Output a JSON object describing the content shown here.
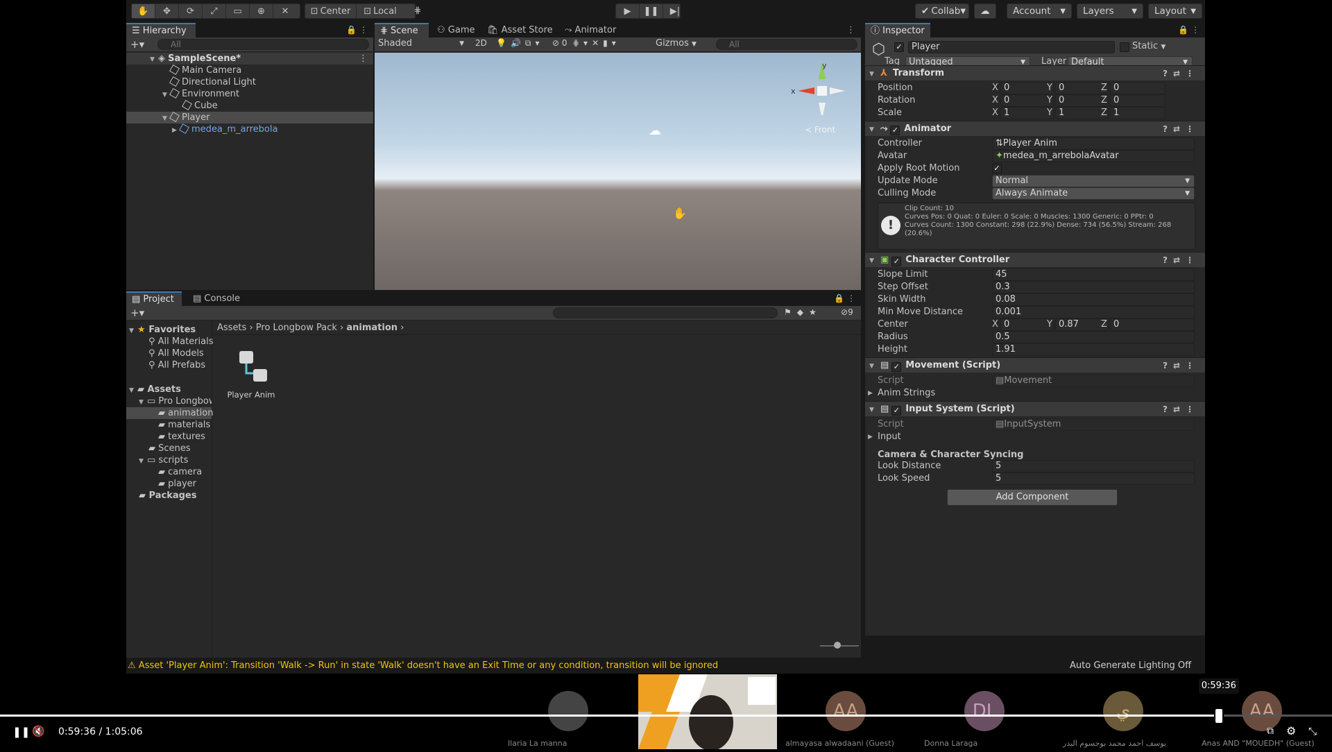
{
  "toolbar": {
    "tools": [
      "✋",
      "✥",
      "⟳",
      "⤢",
      "▭",
      "⊕",
      "✕"
    ],
    "pivot": "Center",
    "space": "Local",
    "collab": "Collab",
    "account": "Account",
    "layers": "Layers",
    "layout": "Layout"
  },
  "hierarchy": {
    "tab": "Hierarchy",
    "search_placeholder": "All",
    "scene": "SampleScene*",
    "items": [
      "Main Camera",
      "Directional Light",
      "Environment",
      "Cube",
      "Player",
      "medea_m_arrebola"
    ]
  },
  "scene": {
    "tabs": [
      "Scene",
      "Game",
      "Asset Store",
      "Animator"
    ],
    "shading": "Shaded",
    "mode_2d": "2D",
    "hidden_count": "0",
    "gizmos": "Gizmos",
    "search_placeholder": "All",
    "gizmo_label": "Front",
    "axis_x": "x",
    "axis_y": "y"
  },
  "project": {
    "tabs": [
      "Project",
      "Console"
    ],
    "favorites_label": "Favorites",
    "favorites": [
      "All Materials",
      "All Models",
      "All Prefabs"
    ],
    "assets_label": "Assets",
    "tree": [
      "Pro Longbow",
      "animation",
      "materials",
      "textures",
      "Scenes",
      "scripts",
      "camera",
      "player"
    ],
    "packages_label": "Packages",
    "breadcrumb": [
      "Assets",
      "Pro Longbow Pack",
      "animation"
    ],
    "hidden_count": "9",
    "asset_name": "Player Anim"
  },
  "inspector": {
    "tab": "Inspector",
    "object_name": "Player",
    "static_label": "Static",
    "tag_label": "Tag",
    "tag_value": "Untagged",
    "layer_label": "Layer",
    "layer_value": "Default",
    "transform": {
      "title": "Transform",
      "position_label": "Position",
      "position": [
        "0",
        "0",
        "0"
      ],
      "rotation_label": "Rotation",
      "rotation": [
        "0",
        "0",
        "0"
      ],
      "scale_label": "Scale",
      "scale": [
        "1",
        "1",
        "1"
      ]
    },
    "animator": {
      "title": "Animator",
      "controller_label": "Controller",
      "controller": "Player Anim",
      "avatar_label": "Avatar",
      "avatar": "medea_m_arrebolaAvatar",
      "root_motion_label": "Apply Root Motion",
      "update_mode_label": "Update Mode",
      "update_mode": "Normal",
      "culling_mode_label": "Culling Mode",
      "culling_mode": "Always Animate",
      "info_1": "Clip Count: 10",
      "info_2": "Curves Pos: 0 Quat: 0 Euler: 0 Scale: 0 Muscles: 1300 Generic: 0 PPtr: 0",
      "info_3": "Curves Count: 1300 Constant: 298 (22.9%) Dense: 734 (56.5%) Stream: 268",
      "info_4": "(20.6%)"
    },
    "character_controller": {
      "title": "Character Controller",
      "slope_limit_label": "Slope Limit",
      "slope_limit": "45",
      "step_offset_label": "Step Offset",
      "step_offset": "0.3",
      "skin_width_label": "Skin Width",
      "skin_width": "0.08",
      "min_move_label": "Min Move Distance",
      "min_move": "0.001",
      "center_label": "Center",
      "center": [
        "0",
        "0.87",
        "0"
      ],
      "radius_label": "Radius",
      "radius": "0.5",
      "height_label": "Height",
      "height": "1.91"
    },
    "movement": {
      "title": "Movement (Script)",
      "script_label": "Script",
      "script": "Movement",
      "anim_strings": "Anim Strings"
    },
    "input_system": {
      "title": "Input System (Script)",
      "script_label": "Script",
      "script": "InputSystem",
      "input_label": "Input",
      "sync_heading": "Camera & Character Syncing",
      "look_distance_label": "Look Distance",
      "look_distance": "5",
      "look_speed_label": "Look Speed",
      "look_speed": "5"
    },
    "add_component": "Add Component"
  },
  "status": {
    "warning": "Asset 'Player Anim': Transition 'Walk -> Run' in state 'Walk' doesn't have an Exit Time or any condition, transition will be ignored",
    "lighting": "Auto Generate Lighting Off"
  },
  "video": {
    "current_time": "0:59:36",
    "separator": "/",
    "duration": "1:05:06",
    "tooltip_time": "0:59:36",
    "progress": 0.915,
    "participants": [
      {
        "initials": "",
        "name": "Ilaria  La manna"
      },
      {
        "initials": "",
        "name": ""
      },
      {
        "initials": "AA",
        "name": "almayasa alwadaani (Guest)"
      },
      {
        "initials": "DL",
        "name": "Donna Laraga"
      },
      {
        "initials": "ي",
        "name": "يوسف احمد محمد بوجسوم البدر"
      },
      {
        "initials": "AA",
        "name": "Anas AND \"MOUEDH\" (Guest)"
      }
    ]
  },
  "axis_labels": {
    "x": "X",
    "y": "Y",
    "z": "Z"
  }
}
